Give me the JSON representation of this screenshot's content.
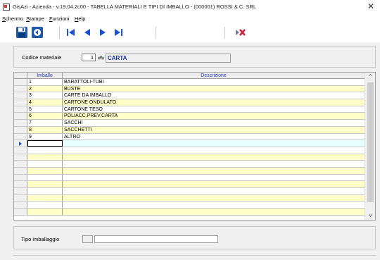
{
  "window": {
    "title": "GisAzi - Azienda - v.19.04.2c00 - TABELLA MATERIALI E TIPI DI IMBALLO - (000001) ROSSI & C. SRL",
    "close_glyph": "✕"
  },
  "menu": [
    {
      "pre": "",
      "u": "S",
      "post": "chermo"
    },
    {
      "pre": "",
      "u": "S",
      "post": "tampe"
    },
    {
      "pre": "",
      "u": "F",
      "post": "unzioni"
    },
    {
      "pre": "",
      "u": "H",
      "post": "elp"
    }
  ],
  "toolbar": {
    "save_icon": "floppy-disk-icon",
    "undo_icon": "back-circle-icon",
    "first_icon": "first-record-icon",
    "prev_icon": "previous-record-icon",
    "next_icon": "next-record-icon",
    "last_icon": "last-record-icon",
    "delete_icon": "delete-record-icon"
  },
  "form": {
    "codice_label": "Codice materiale",
    "codice_value": "1",
    "descrizione_value": "CARTA"
  },
  "grid": {
    "headers": [
      "Imballo",
      "Descrizione"
    ],
    "rows": [
      {
        "imballo": "1",
        "descrizione": "BARATTOLI-TUBI"
      },
      {
        "imballo": "2",
        "descrizione": "BUSTE"
      },
      {
        "imballo": "3",
        "descrizione": "CARTE DA IMBALLO"
      },
      {
        "imballo": "4",
        "descrizione": "CARTONE ONDULATO"
      },
      {
        "imballo": "5",
        "descrizione": "CARTONE TESO"
      },
      {
        "imballo": "6",
        "descrizione": "POLIACC.PREV.CARTA"
      },
      {
        "imballo": "7",
        "descrizione": "SACCHI"
      },
      {
        "imballo": "8",
        "descrizione": "SACCHETTI"
      },
      {
        "imballo": "9",
        "descrizione": "ALTRO"
      },
      {
        "imballo": "",
        "descrizione": ""
      },
      {
        "imballo": "",
        "descrizione": ""
      },
      {
        "imballo": "",
        "descrizione": ""
      },
      {
        "imballo": "",
        "descrizione": ""
      },
      {
        "imballo": "",
        "descrizione": ""
      },
      {
        "imballo": "",
        "descrizione": ""
      },
      {
        "imballo": "",
        "descrizione": ""
      },
      {
        "imballo": "",
        "descrizione": ""
      },
      {
        "imballo": "",
        "descrizione": ""
      },
      {
        "imballo": "",
        "descrizione": ""
      },
      {
        "imballo": "",
        "descrizione": ""
      }
    ],
    "current_row": 9,
    "scroll_up": "^",
    "scroll_down": "v"
  },
  "bottom": {
    "tipo_label": "Tipo imballaggio"
  },
  "colors": {
    "row_alt": "#ffffc8",
    "row_current": "#e6ffff",
    "header_text": "#2a3cb0",
    "accent_blue": "#1a4fd0",
    "delete_red": "#d21f3c"
  }
}
